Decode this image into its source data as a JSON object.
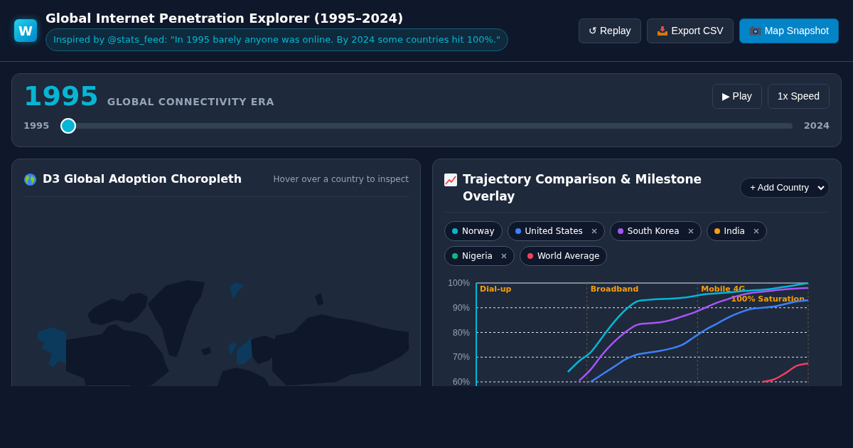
{
  "header": {
    "logo": "W",
    "title": "Global Internet Penetration Explorer (1995–2024)",
    "quote": "Inspired by @stats_feed: \"In 1995 barely anyone was online. By 2024 some countries hit 100%.\"",
    "buttons": [
      {
        "label": "↺ Replay",
        "kind": "plain"
      },
      {
        "label": "Export CSV",
        "kind": "export"
      },
      {
        "label": "Map Snapshot",
        "kind": "camera"
      }
    ]
  },
  "timeline": {
    "year": "1995",
    "era": "GLOBAL CONNECTIVITY ERA",
    "play": "▶ Play",
    "speed": "1x Speed",
    "start": "1995",
    "end": "2024",
    "level": 0
  },
  "map_panel": {
    "title": "D3 Global Adoption Choropleth",
    "hint": "Hover over a country to inspect"
  },
  "chart_panel": {
    "title": "Trajectory Comparison & Milestone Overlay",
    "add_country": "+ Add Country",
    "chips": [
      {
        "label": "Norway",
        "color": "#06b6d4",
        "removable": false
      },
      {
        "label": "United States",
        "color": "#3b82f6",
        "removable": true
      },
      {
        "label": "South Korea",
        "color": "#a855f7",
        "removable": true
      },
      {
        "label": "India",
        "color": "#f59e0b",
        "removable": true
      },
      {
        "label": "Nigeria",
        "color": "#10b981",
        "removable": true
      },
      {
        "label": "World Average",
        "color": "#f43f5e",
        "removable": false
      }
    ],
    "milestones": [
      "Dial-up",
      "Broadband",
      "Mobile 4G",
      "100% Saturation"
    ],
    "chart_data": {
      "type": "line",
      "grid": true,
      "ylim": [
        60,
        100
      ],
      "yticks": [
        {
          "value": 60,
          "label": "60%"
        },
        {
          "value": 70,
          "label": "70%"
        },
        {
          "value": 80,
          "label": "80%"
        },
        {
          "value": 90,
          "label": "90%"
        },
        {
          "value": 100,
          "label": "100%"
        }
      ],
      "series": [
        {
          "color": "#06b6d4",
          "values": [
            null,
            null,
            null,
            null,
            null,
            null,
            null,
            null,
            64,
            68.5,
            72,
            78,
            84,
            89,
            92.5,
            93.2,
            93.5,
            93.7,
            94,
            94.7,
            95.5,
            95.8,
            96.2,
            96.6,
            97,
            97.3,
            97.8,
            98.5,
            99.2,
            100
          ]
        },
        {
          "color": "#a855f7",
          "values": [
            null,
            null,
            null,
            null,
            null,
            null,
            null,
            null,
            null,
            60.5,
            65,
            71,
            76,
            80,
            83,
            83.7,
            84,
            85,
            86.5,
            88,
            90,
            92,
            93.5,
            95,
            96,
            96.5,
            97,
            97.5,
            97.8,
            98
          ]
        },
        {
          "color": "#3b82f6",
          "values": [
            null,
            null,
            null,
            null,
            null,
            null,
            null,
            null,
            null,
            null,
            60,
            63,
            66,
            69,
            71,
            71.8,
            72.5,
            73.5,
            75,
            78,
            81,
            83.5,
            86,
            88,
            89.5,
            90,
            90.5,
            91.5,
            92.5,
            93
          ]
        },
        {
          "color": "#f43f5e",
          "values": [
            null,
            null,
            null,
            null,
            null,
            null,
            null,
            null,
            null,
            null,
            null,
            null,
            null,
            null,
            null,
            null,
            null,
            null,
            null,
            null,
            null,
            null,
            null,
            null,
            null,
            60,
            61,
            63.5,
            66.5,
            67.5
          ]
        }
      ]
    }
  }
}
